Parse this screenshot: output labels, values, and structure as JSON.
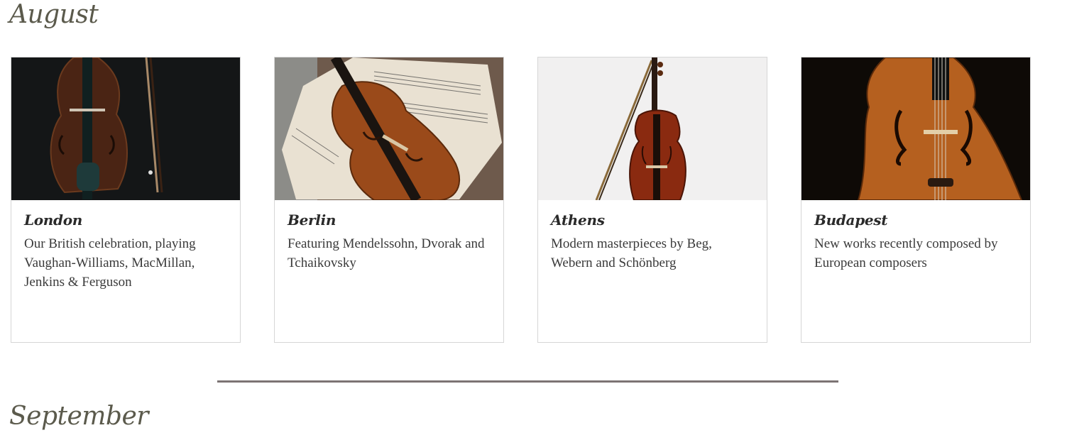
{
  "sections": [
    {
      "month": "August",
      "cards": [
        {
          "city": "London",
          "description": "Our British celebration, playing Vaughan-Williams, MacMillan, Jenkins & Ferguson",
          "image": "violin-and-bow-on-dark-background"
        },
        {
          "city": "Berlin",
          "description": "Featuring Mendelssohn, Dvorak and Tchaikovsky",
          "image": "violin-on-sheet-music"
        },
        {
          "city": "Athens",
          "description": "Modern masterpieces by Beg, Webern and Schönberg",
          "image": "violin-and-bow-on-white-background"
        },
        {
          "city": "Budapest",
          "description": "New works recently composed by European composers",
          "image": "cello-closeup-dark-background"
        }
      ]
    },
    {
      "month": "September",
      "cards": []
    }
  ],
  "colors": {
    "month_title": "#5b5a4c",
    "card_border": "#d6d6d6",
    "divider": "#7c7474",
    "wood": "#8a3b12"
  }
}
